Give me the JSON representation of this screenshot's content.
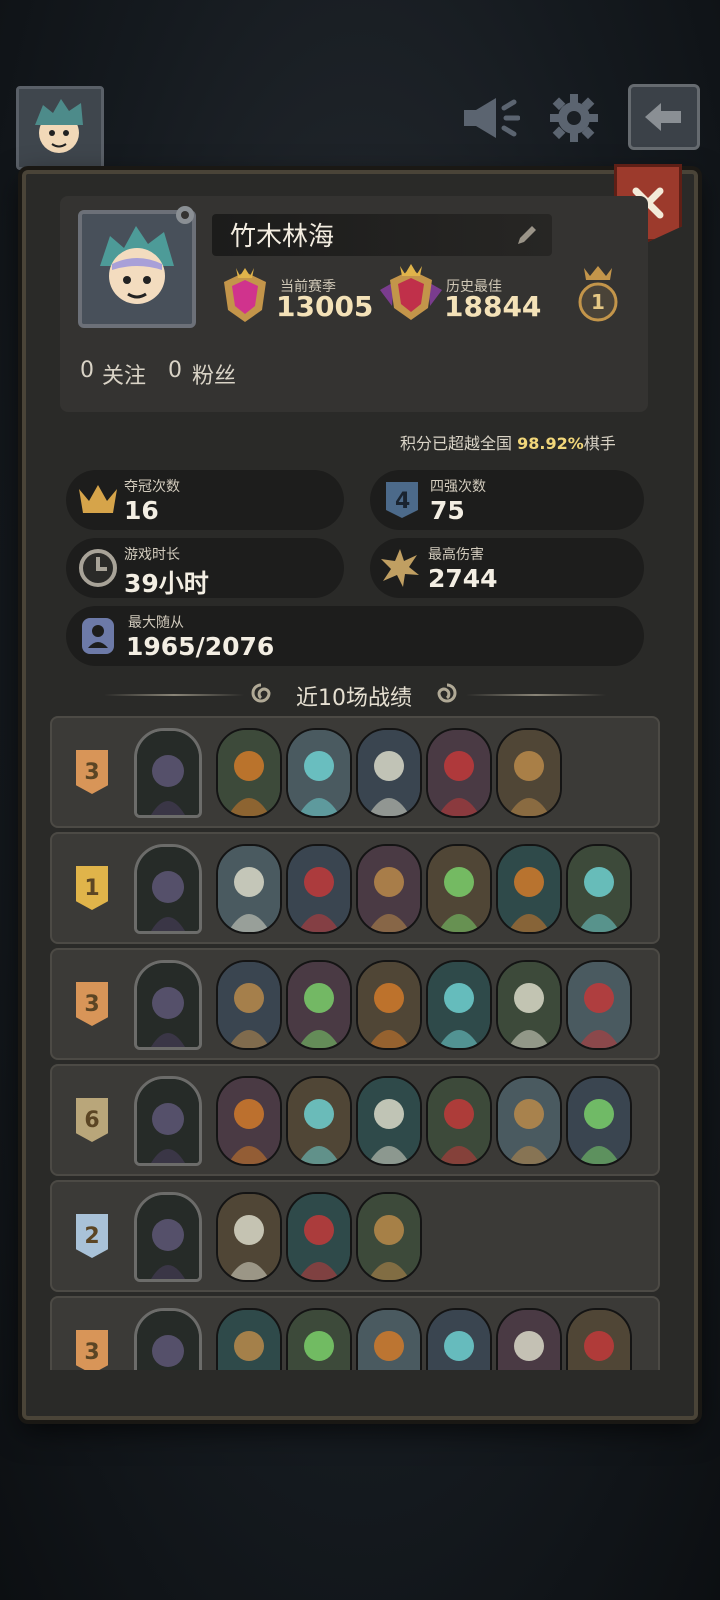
{
  "player": {
    "name": "竹木林海",
    "current_season_label": "当前赛季",
    "current_season_score": "13005",
    "best_label": "历史最佳",
    "best_score": "18844",
    "crown_rank": "1",
    "follow_count": "0",
    "follow_label": "关注",
    "fans_count": "0",
    "fans_label": "粉丝"
  },
  "percentile": {
    "prefix": "积分已超越全国",
    "value": "98.92%",
    "suffix": "棋手"
  },
  "stats": {
    "champion": {
      "label": "夺冠次数",
      "value": "16"
    },
    "top4": {
      "label": "四强次数",
      "value": "75"
    },
    "playtime": {
      "label": "游戏时长",
      "value": "39小时"
    },
    "max_damage": {
      "label": "最高伤害",
      "value": "2744"
    },
    "max_minions": {
      "label": "最大随从",
      "value": "1965/2076"
    }
  },
  "recent": {
    "title": "近10场战绩",
    "matches": [
      {
        "place": "3",
        "units": 5
      },
      {
        "place": "1",
        "units": 6
      },
      {
        "place": "3",
        "units": 6
      },
      {
        "place": "6",
        "units": 6
      },
      {
        "place": "2",
        "units": 3
      },
      {
        "place": "3",
        "units": 6
      }
    ]
  },
  "colors": {
    "gold": "#f1d67a",
    "close_red": "#9c3a2c",
    "place_1": "#e0b44a",
    "place_2": "#a9c2d8",
    "place_3": "#d89558",
    "place_6": "#b9a67a"
  },
  "icons": {
    "close": "x-icon",
    "sound": "megaphone-icon",
    "settings": "gear-icon",
    "back": "back-arrow-icon"
  }
}
